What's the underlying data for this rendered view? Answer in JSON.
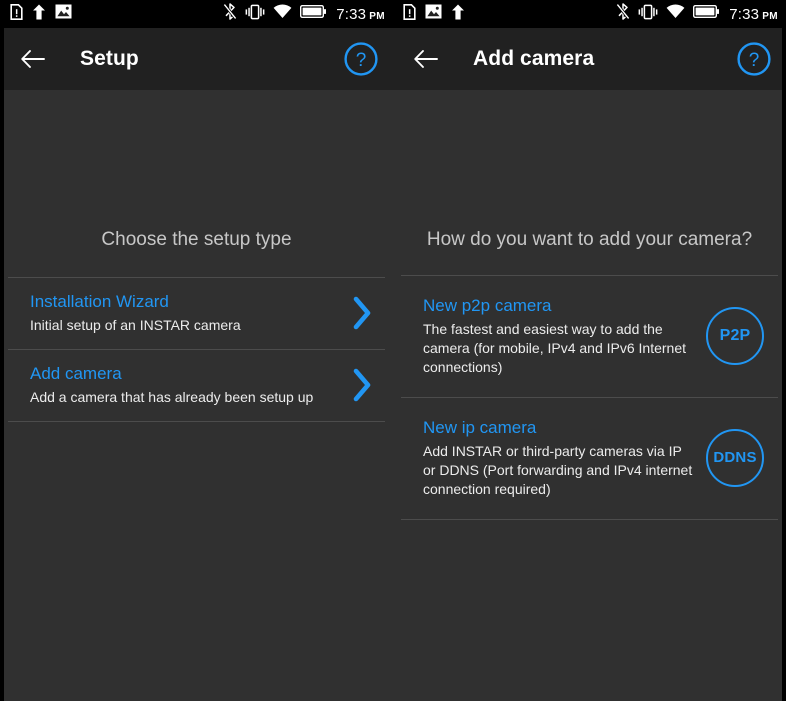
{
  "status_bar": {
    "time": "7:33",
    "ampm": "PM",
    "left_icons": [
      "sim-card-alert-icon",
      "upload-icon",
      "image-icon"
    ],
    "right_icons": [
      "bluetooth-off-icon",
      "vibrate-icon",
      "wifi-icon",
      "battery-icon"
    ]
  },
  "accent_color": "#2196f3",
  "panels": [
    {
      "appbar": {
        "back_label": "back-arrow",
        "title": "Setup",
        "help_label": "?"
      },
      "heading": "Choose the setup type",
      "items": [
        {
          "title": "Installation Wizard",
          "subtitle": "Initial setup of an INSTAR camera",
          "accessory": "chevron-right"
        },
        {
          "title": "Add camera",
          "subtitle": "Add a camera that has already been setup up",
          "accessory": "chevron-right"
        }
      ]
    },
    {
      "appbar": {
        "back_label": "back-arrow",
        "title": "Add camera",
        "help_label": "?"
      },
      "heading": "How do you want to add your camera?",
      "items": [
        {
          "title": "New p2p camera",
          "subtitle": "The fastest and easiest way to add the camera (for mobile, IPv4 and IPv6 Internet connections)",
          "accessory": "badge",
          "badge_label": "P2P"
        },
        {
          "title": "New ip camera",
          "subtitle": "Add INSTAR or third-party cameras via IP or DDNS (Port forwarding and IPv4 internet connection required)",
          "accessory": "badge",
          "badge_label": "DDNS"
        }
      ]
    }
  ]
}
